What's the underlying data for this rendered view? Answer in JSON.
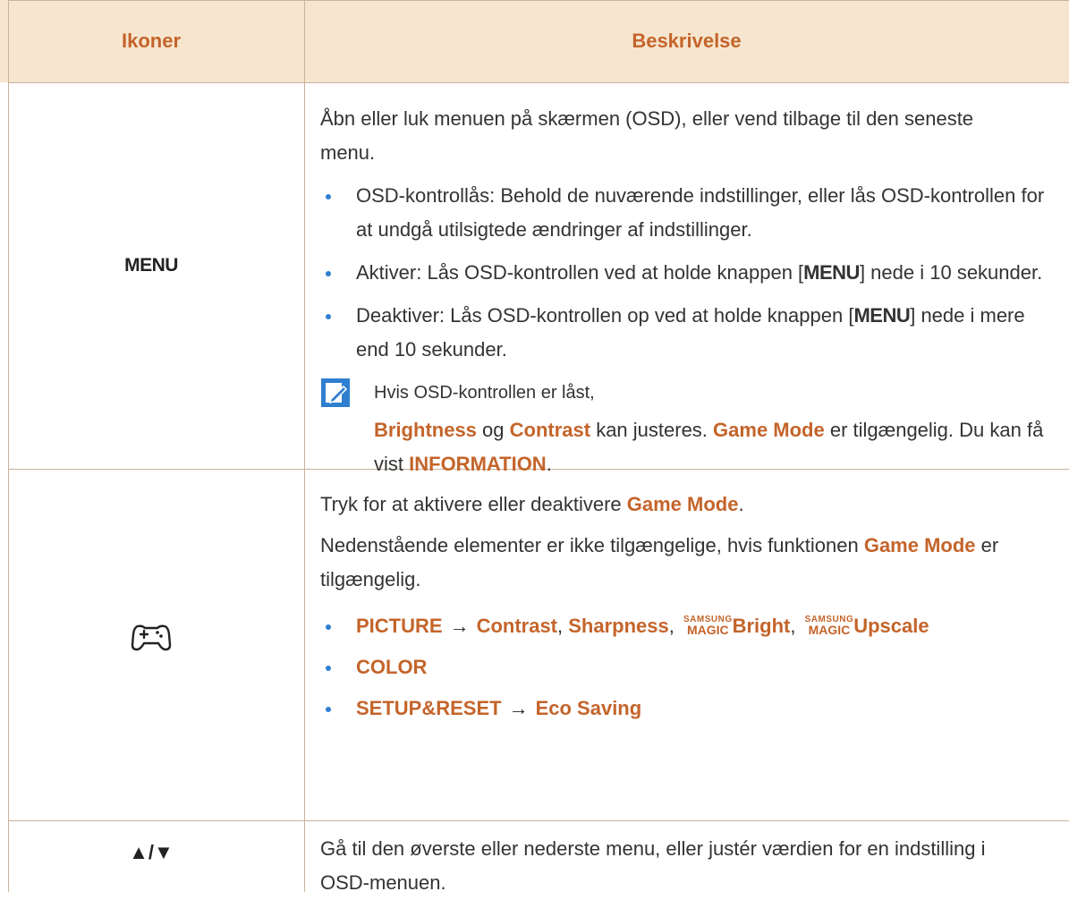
{
  "header": {
    "col_icons": "Ikoner",
    "col_desc": "Beskrivelse"
  },
  "rows": [
    {
      "icon_label": "MENU",
      "intro": "Åbn eller luk menuen på skærmen (OSD), eller vend tilbage til den seneste menu.",
      "b1": "OSD-kontrollås: Behold de nuværende indstillinger, eller lås OSD-kontrollen for at undgå utilsigtede ændringer af indstillinger.",
      "b2_a": "Aktiver: Lås OSD-kontrollen ved at holde knappen [",
      "b2_key": "MENU",
      "b2_b": "] nede i 10 sekunder.",
      "b3_a": "Deaktiver: Lås OSD-kontrollen op ved at holde knappen [",
      "b3_key": "MENU",
      "b3_b": "] nede i mere end 10 sekunder.",
      "note_line1": "Hvis OSD-kontrollen er låst,",
      "note_brightness": "Brightness",
      "note_og": " og ",
      "note_contrast": "Contrast",
      "note_mid": " kan justeres. ",
      "note_gamemode": "Game Mode",
      "note_mid2": " er tilgængelig. Du kan få vist ",
      "note_information": "INFORMATION",
      "note_end": "."
    },
    {
      "icon_name": "gamepad-icon",
      "p1_a": "Tryk for at aktivere eller deaktivere ",
      "p1_gm": "Game Mode",
      "p1_end": ".",
      "p2_a": "Nedenstående elementer er ikke tilgængelige, hvis funktionen ",
      "p2_gm": "Game Mode",
      "p2_end": " er tilgængelig.",
      "l1_picture": "PICTURE",
      "arrow": "→",
      "l1_contrast": "Contrast",
      "comma": ", ",
      "l1_sharpness": "Sharpness",
      "magic_top": "SAMSUNG",
      "magic_bottom": "MAGIC",
      "l1_bright": "Bright",
      "l1_upscale": "Upscale",
      "l2": "COLOR",
      "l3_setup": "SETUP&RESET",
      "l3_eco": "Eco Saving"
    },
    {
      "icon_label": "▲/▼",
      "text": "Gå til den øverste eller nederste menu, eller justér værdien for en indstilling i OSD-menuen."
    }
  ],
  "colors": {
    "accent": "#c4642a",
    "header_bg": "#f6e6cf",
    "bullet": "#2f7fd0",
    "border": "#c9b39a"
  }
}
